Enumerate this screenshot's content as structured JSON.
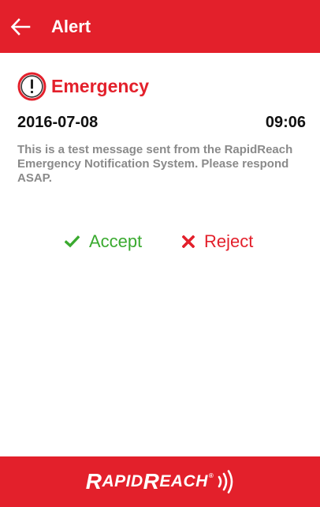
{
  "app_bar": {
    "title": "Alert",
    "back_icon": "arrow-left-icon"
  },
  "alert": {
    "icon": "exclamation-circle-icon",
    "type": "Emergency",
    "date": "2016-07-08",
    "time": "09:06",
    "message": "This is a test message sent from the RapidReach Emergency Notification System. Please respond ASAP."
  },
  "actions": {
    "accept_label": "Accept",
    "accept_icon": "checkmark-icon",
    "reject_label": "Reject",
    "reject_icon": "x-icon"
  },
  "footer": {
    "logo_text": "RapidReach",
    "logo_icon": "signal-waves-icon"
  },
  "colors": {
    "brand_red": "#e3202b",
    "accept_green": "#3aaa2f",
    "message_gray": "#8a8a8a",
    "text_dark": "#111111"
  }
}
